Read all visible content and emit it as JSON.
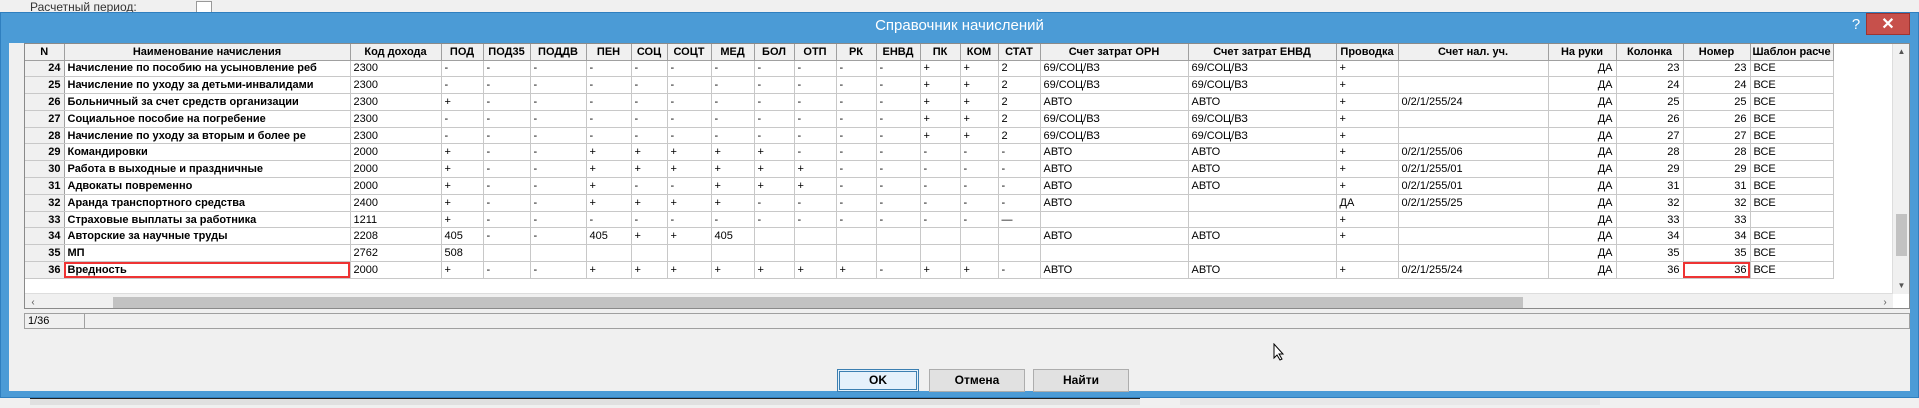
{
  "background": {
    "top_label": "Расчетный период:"
  },
  "window": {
    "title": "Справочник начислений",
    "help_label": "?",
    "close_label": "✕"
  },
  "grid": {
    "columns": [
      "N",
      "Наименование начисления",
      "Код дохода",
      "ПОД",
      "ПОД35",
      "ПОДДВ",
      "ПЕН",
      "СОЦ",
      "СОЦТ",
      "МЕД",
      "БОЛ",
      "ОТП",
      "РК",
      "ЕНВД",
      "ПК",
      "КОМ",
      "СТАТ",
      "Счет затрат ОРН",
      "Счет затрат ЕНВД",
      "Проводка",
      "Счет нал. уч.",
      "На руки",
      "Колонка",
      "Номер",
      "Шаблон расче"
    ],
    "rows": [
      [
        "24",
        "Начисление по пособию на усыновление реб",
        "2300",
        "-",
        "-",
        "-",
        "-",
        "-",
        "-",
        "-",
        "-",
        "-",
        "-",
        "-",
        "+",
        "+",
        "2",
        "69/СОЦ/ВЗ",
        "69/СОЦ/ВЗ",
        "+",
        "",
        "ДА",
        "23",
        "23",
        "ВСЕ"
      ],
      [
        "25",
        "Начисление по уходу за детьми-инвалидами",
        "2300",
        "-",
        "-",
        "-",
        "-",
        "-",
        "-",
        "-",
        "-",
        "-",
        "-",
        "-",
        "+",
        "+",
        "2",
        "69/СОЦ/ВЗ",
        "69/СОЦ/ВЗ",
        "+",
        "",
        "ДА",
        "24",
        "24",
        "ВСЕ"
      ],
      [
        "26",
        "Больничный за счет средств организации",
        "2300",
        "+",
        "-",
        "-",
        "-",
        "-",
        "-",
        "-",
        "-",
        "-",
        "-",
        "-",
        "+",
        "+",
        "2",
        "АВТО",
        "АВТО",
        "+",
        "0/2/1/255/24",
        "ДА",
        "25",
        "25",
        "ВСЕ"
      ],
      [
        "27",
        "Социальное пособие на погребение",
        "2300",
        "-",
        "-",
        "-",
        "-",
        "-",
        "-",
        "-",
        "-",
        "-",
        "-",
        "-",
        "+",
        "+",
        "2",
        "69/СОЦ/ВЗ",
        "69/СОЦ/ВЗ",
        "+",
        "",
        "ДА",
        "26",
        "26",
        "ВСЕ"
      ],
      [
        "28",
        "Начисление по уходу за вторым и более ре",
        "2300",
        "-",
        "-",
        "-",
        "-",
        "-",
        "-",
        "-",
        "-",
        "-",
        "-",
        "-",
        "+",
        "+",
        "2",
        "69/СОЦ/ВЗ",
        "69/СОЦ/ВЗ",
        "+",
        "",
        "ДА",
        "27",
        "27",
        "ВСЕ"
      ],
      [
        "29",
        "Командировки",
        "2000",
        "+",
        "-",
        "-",
        "+",
        "+",
        "+",
        "+",
        "+",
        "-",
        "-",
        "-",
        "-",
        "-",
        "-",
        "АВТО",
        "АВТО",
        "+",
        "0/2/1/255/06",
        "ДА",
        "28",
        "28",
        "ВСЕ"
      ],
      [
        "30",
        "Работа в выходные и праздничные",
        "2000",
        "+",
        "-",
        "-",
        "+",
        "+",
        "+",
        "+",
        "+",
        "+",
        "-",
        "-",
        "-",
        "-",
        "-",
        "АВТО",
        "АВТО",
        "+",
        "0/2/1/255/01",
        "ДА",
        "29",
        "29",
        "ВСЕ"
      ],
      [
        "31",
        "Адвокаты повременно",
        "2000",
        "+",
        "-",
        "-",
        "+",
        "-",
        "-",
        "+",
        "+",
        "+",
        "-",
        "-",
        "-",
        "-",
        "-",
        "АВТО",
        "АВТО",
        "+",
        "0/2/1/255/01",
        "ДА",
        "31",
        "31",
        "ВСЕ"
      ],
      [
        "32",
        "Аранда транспортного средства",
        "2400",
        "+",
        "-",
        "-",
        "+",
        "+",
        "+",
        "+",
        "-",
        "-",
        "-",
        "-",
        "-",
        "-",
        "-",
        "АВТО",
        "",
        "ДА",
        "0/2/1/255/25",
        "ДА",
        "32",
        "32",
        "ВСЕ"
      ],
      [
        "33",
        "Страховые выплаты за работника",
        "1211",
        "+",
        "-",
        "-",
        "-",
        "-",
        "-",
        "-",
        "-",
        "-",
        "-",
        "-",
        "-",
        "-",
        "—",
        "",
        "",
        "+",
        "",
        "ДА",
        "33",
        "33",
        ""
      ],
      [
        "34",
        "Авторские за научные труды",
        "2208",
        "405",
        "-",
        "-",
        "405",
        "+",
        "+",
        "405",
        "",
        "",
        "",
        "",
        "",
        "",
        "",
        "АВТО",
        "АВТО",
        "+",
        "",
        "ДА",
        "34",
        "34",
        "ВСЕ"
      ],
      [
        "35",
        "МП",
        "2762",
        "508",
        "",
        "",
        "",
        "",
        "",
        "",
        "",
        "",
        "",
        "",
        "",
        "",
        "",
        "",
        "",
        "",
        "",
        "ДА",
        "35",
        "35",
        "ВСЕ"
      ],
      [
        "36",
        "Вредность",
        "2000",
        "+",
        "-",
        "-",
        "+",
        "+",
        "+",
        "+",
        "+",
        "+",
        "+",
        "-",
        "+",
        "+",
        "-",
        "АВТО",
        "АВТО",
        "+",
        "0/2/1/255/24",
        "ДА",
        "36",
        "36",
        "ВСЕ"
      ]
    ]
  },
  "status": {
    "position": "1/36"
  },
  "buttons": {
    "ok": "OK",
    "cancel": "Отмена",
    "find": "Найти"
  }
}
